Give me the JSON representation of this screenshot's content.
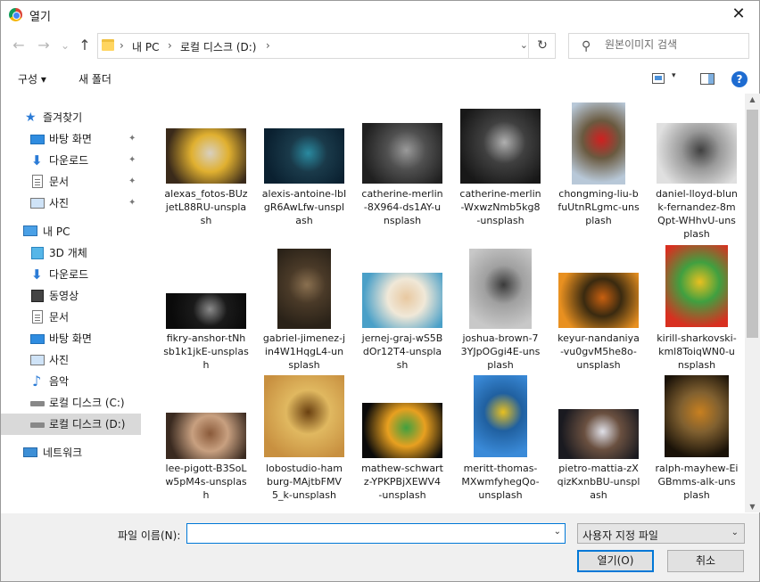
{
  "window": {
    "title": "열기",
    "close": "✕"
  },
  "nav": {
    "back": "←",
    "forward": "→",
    "recent": "⌄",
    "up": "↑"
  },
  "address": {
    "sep": "›",
    "crumbs": [
      "내 PC",
      "로컬 디스크 (D:)"
    ],
    "dropdown": "⌄",
    "refresh": "↻"
  },
  "search": {
    "placeholder": "원본이미지 검색"
  },
  "toolbar": {
    "organize": "구성 ▾",
    "new_folder": "새 폴더",
    "view_dd": "▾",
    "help": "?"
  },
  "sidebar": {
    "pin": "📌",
    "items": [
      {
        "label": "즐겨찾기",
        "icon": "star-icon"
      },
      {
        "label": "바탕 화면",
        "icon": "desktop-icon"
      },
      {
        "label": "다운로드",
        "icon": "download-icon"
      },
      {
        "label": "문서",
        "icon": "document-icon"
      },
      {
        "label": "사진",
        "icon": "pictures-icon"
      },
      {
        "label": "내 PC",
        "icon": "pc-icon"
      },
      {
        "label": "3D 개체",
        "icon": "3d-objects-icon"
      },
      {
        "label": "다운로드",
        "icon": "download-icon"
      },
      {
        "label": "동영상",
        "icon": "video-icon"
      },
      {
        "label": "문서",
        "icon": "document-icon"
      },
      {
        "label": "바탕 화면",
        "icon": "desktop-icon"
      },
      {
        "label": "사진",
        "icon": "pictures-icon"
      },
      {
        "label": "음악",
        "icon": "music-icon"
      },
      {
        "label": "로컬 디스크 (C:)",
        "icon": "drive-icon"
      },
      {
        "label": "로컬 디스크 (D:)",
        "icon": "drive-icon"
      },
      {
        "label": "네트워크",
        "icon": "network-icon"
      }
    ]
  },
  "files": [
    {
      "name": "alexas_fotos-BUzjetL88RU-unsplash",
      "lines": [
        "alexas_fotos-BUz",
        "jetL88RU-unspla",
        "sh"
      ],
      "colors": [
        "#3a2a1a",
        "#d8d0c0",
        "#e0b030"
      ]
    },
    {
      "name": "alexis-antoine-lbIgR6AwLfw-unsplash",
      "lines": [
        "alexis-antoine-lbI",
        "gR6AwLfw-unspl",
        "ash"
      ],
      "colors": [
        "#0a2030",
        "#2a8aa0",
        "#1a3a4a"
      ]
    },
    {
      "name": "catherine-merlin-8X964-ds1AY-unsplash",
      "lines": [
        "catherine-merlin",
        "-8X964-ds1AY-u",
        "nsplash"
      ],
      "colors": [
        "#202020",
        "#9a9a9a",
        "#505050"
      ]
    },
    {
      "name": "catherine-merlin-WxwzNmb5kg8-unsplash",
      "lines": [
        "catherine-merlin",
        "-WxwzNmb5kg8",
        "-unsplash"
      ],
      "colors": [
        "#181818",
        "#b0b0b0",
        "#404040"
      ]
    },
    {
      "name": "chongming-liu-bfuUtnRLgmc-unsplash",
      "lines": [
        "chongming-liu-b",
        "fuUtnRLgmc-uns",
        "plash"
      ],
      "colors": [
        "#b8c8d8",
        "#d02020",
        "#6a5a40"
      ]
    },
    {
      "name": "daniel-lloyd-blunk-fernandez-8mQpt-WHhvU-unsplash",
      "lines": [
        "daniel-lloyd-blun",
        "k-fernandez-8m",
        "Qpt-WHhvU-uns",
        "plash"
      ],
      "colors": [
        "#e0e0e0",
        "#404040",
        "#9a9a9a"
      ]
    },
    {
      "name": "fikry-anshor-tNhsb1k1jkE-unsplash",
      "lines": [
        "fikry-anshor-tNh",
        "sb1k1jkE-unsplas",
        "h"
      ],
      "colors": [
        "#0a0a0a",
        "#8a8a8a",
        "#1a1a1a"
      ]
    },
    {
      "name": "gabriel-jimenez-jin4W1HqgL4-unsplash",
      "lines": [
        "gabriel-jimenez-j",
        "in4W1HqgL4-un",
        "splash"
      ],
      "colors": [
        "#2a2218",
        "#8a7050",
        "#4a3a28"
      ]
    },
    {
      "name": "jernej-graj-wS5BdOr12T4-unsplash",
      "lines": [
        "jernej-graj-wS5B",
        "dOr12T4-unspla",
        "sh"
      ],
      "colors": [
        "#4aa0c8",
        "#e8c8a0",
        "#f0e8d8"
      ]
    },
    {
      "name": "joshua-brown-73YJpOGgi4E-unsplash",
      "lines": [
        "joshua-brown-7",
        "3YJpOGgi4E-uns",
        "plash"
      ],
      "colors": [
        "#c8c8c8",
        "#3a3a3a",
        "#a0a0a0"
      ]
    },
    {
      "name": "keyur-nandaniya-vu0gvM5he8o-unsplash",
      "lines": [
        "keyur-nandaniya",
        "-vu0gvM5he8o-",
        "unsplash"
      ],
      "colors": [
        "#e89020",
        "#c86010",
        "#3a2a10"
      ]
    },
    {
      "name": "kirill-sharkovski-kml8ToiqWN0-unsplash",
      "lines": [
        "kirill-sharkovski-",
        "kml8ToiqWN0-u",
        "nsplash"
      ],
      "colors": [
        "#d83020",
        "#e8c020",
        "#40a040"
      ]
    },
    {
      "name": "lee-pigott-B3SoLw5pM4s-unsplash",
      "lines": [
        "lee-pigott-B3SoL",
        "w5pM4s-unsplas",
        "h"
      ],
      "colors": [
        "#3a2a20",
        "#8a5a3a",
        "#c8a080"
      ]
    },
    {
      "name": "lobostudio-hamburg-MAjtbFMV5_k-unsplash",
      "lines": [
        "lobostudio-ham",
        "burg-MAjtbFMV",
        "5_k-unsplash"
      ],
      "colors": [
        "#c89040",
        "#6a4010",
        "#e0b860"
      ]
    },
    {
      "name": "mathew-schwartz-YPKPBjXEWV4-unsplash",
      "lines": [
        "mathew-schwart",
        "z-YPKPBjXEWV4",
        "-unsplash"
      ],
      "colors": [
        "#0a0a0a",
        "#40a040",
        "#e8a020"
      ]
    },
    {
      "name": "meritt-thomas-MXwmfyhegQo-unsplash",
      "lines": [
        "meritt-thomas-",
        "MXwmfyhegQo-",
        "unsplash"
      ],
      "colors": [
        "#3a8ad8",
        "#e8c020",
        "#2060a0"
      ]
    },
    {
      "name": "pietro-mattia-zXqizKxnbBU-unsplash",
      "lines": [
        "pietro-mattia-zX",
        "qizKxnbBU-unspl",
        "ash"
      ],
      "colors": [
        "#1a1a20",
        "#e0e0e8",
        "#6a5040"
      ]
    },
    {
      "name": "ralph-mayhew-EiGBmms-alk-unsplash",
      "lines": [
        "ralph-mayhew-Ei",
        "GBmms-alk-uns",
        "plash"
      ],
      "colors": [
        "#1a1208",
        "#c88020",
        "#806030"
      ]
    }
  ],
  "scroll": {
    "up": "▲",
    "down": "▼"
  },
  "footer": {
    "filename_label": "파일 이름(N):",
    "filename_value": "",
    "filename_dd": "⌄",
    "filter": "사용자 지정 파일",
    "filter_dd": "⌄",
    "open": "열기(O)",
    "cancel": "취소"
  }
}
